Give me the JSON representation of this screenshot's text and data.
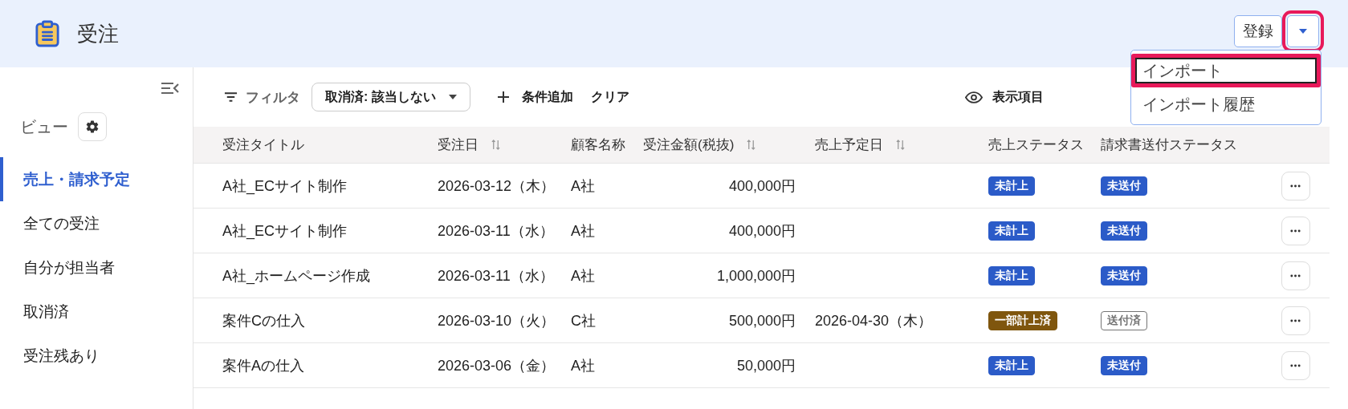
{
  "header": {
    "title": "受注",
    "register_button": "登録",
    "dropdown_button": {
      "highlighted": true
    }
  },
  "dropdown_menu": {
    "items": [
      {
        "label": "インポート",
        "selected": true,
        "highlighted": true
      },
      {
        "label": "インポート履歴",
        "selected": false,
        "highlighted": false
      }
    ]
  },
  "sidebar": {
    "views_label": "ビュー",
    "items": [
      {
        "label": "売上・請求予定",
        "selected": true
      },
      {
        "label": "全ての受注",
        "selected": false
      },
      {
        "label": "自分が担当者",
        "selected": false
      },
      {
        "label": "取消済",
        "selected": false
      },
      {
        "label": "受注残あり",
        "selected": false
      }
    ]
  },
  "toolbar": {
    "filter_label": "フィルタ",
    "filter_chip": "取消済: 該当しない",
    "add_condition": "条件追加",
    "clear": "クリア",
    "columns_button": "表示項目"
  },
  "table": {
    "columns": [
      {
        "label": "受注タイトル",
        "sortable": false
      },
      {
        "label": "受注日",
        "sortable": true
      },
      {
        "label": "顧客名称",
        "sortable": false
      },
      {
        "label": "受注金額(税抜)",
        "sortable": true
      },
      {
        "label": "売上予定日",
        "sortable": true
      },
      {
        "label": "売上ステータス",
        "sortable": false
      },
      {
        "label": "請求書送付ステータス",
        "sortable": false
      }
    ],
    "rows": [
      {
        "title": "A社_ECサイト制作",
        "date": "2026-03-12（木）",
        "customer": "A社",
        "amount": "400,000円",
        "sales_date": "",
        "sales_status": {
          "text": "未計上",
          "kind": "filled",
          "color": "#2b5bc8"
        },
        "invoice_status": {
          "text": "未送付",
          "kind": "filled",
          "color": "#2b5bc8"
        }
      },
      {
        "title": "A社_ECサイト制作",
        "date": "2026-03-11（水）",
        "customer": "A社",
        "amount": "400,000円",
        "sales_date": "",
        "sales_status": {
          "text": "未計上",
          "kind": "filled",
          "color": "#2b5bc8"
        },
        "invoice_status": {
          "text": "未送付",
          "kind": "filled",
          "color": "#2b5bc8"
        }
      },
      {
        "title": "A社_ホームページ作成",
        "date": "2026-03-11（水）",
        "customer": "A社",
        "amount": "1,000,000円",
        "sales_date": "",
        "sales_status": {
          "text": "未計上",
          "kind": "filled",
          "color": "#2b5bc8"
        },
        "invoice_status": {
          "text": "未送付",
          "kind": "filled",
          "color": "#2b5bc8"
        }
      },
      {
        "title": "案件Cの仕入",
        "date": "2026-03-10（火）",
        "customer": "C社",
        "amount": "500,000円",
        "sales_date": "2026-04-30（木）",
        "sales_status": {
          "text": "一部計上済",
          "kind": "filled",
          "color": "#7f560e"
        },
        "invoice_status": {
          "text": "送付済",
          "kind": "outline",
          "color": "#757575"
        }
      },
      {
        "title": "案件Aの仕入",
        "date": "2026-03-06（金）",
        "customer": "A社",
        "amount": "50,000円",
        "sales_date": "",
        "sales_status": {
          "text": "未計上",
          "kind": "filled",
          "color": "#2b5bc8"
        },
        "invoice_status": {
          "text": "未送付",
          "kind": "filled",
          "color": "#2b5bc8"
        }
      }
    ]
  }
}
